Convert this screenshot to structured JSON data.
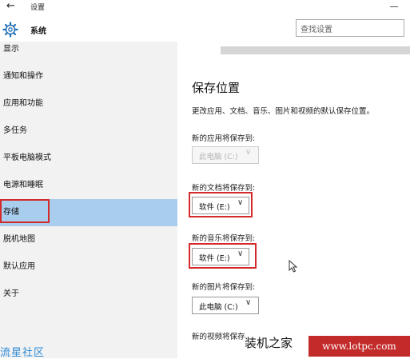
{
  "window": {
    "title": "设置",
    "back_glyph": "←"
  },
  "header": {
    "title": "系统",
    "search_placeholder": "查找设置"
  },
  "sidebar": {
    "items": [
      {
        "label": "显示"
      },
      {
        "label": "通知和操作"
      },
      {
        "label": "应用和功能"
      },
      {
        "label": "多任务"
      },
      {
        "label": "平板电脑模式"
      },
      {
        "label": "电源和睡眠"
      },
      {
        "label": "存储",
        "selected": true
      },
      {
        "label": "脱机地图"
      },
      {
        "label": "默认应用"
      },
      {
        "label": "关于"
      }
    ]
  },
  "main": {
    "title": "保存位置",
    "description": "更改应用、文档、音乐、图片和视频的默认保存位置。",
    "fields": [
      {
        "label": "新的应用将保存到:",
        "value": "此电脑 (C:)",
        "disabled": true,
        "highlighted": false
      },
      {
        "label": "新的文档将保存到:",
        "value": "软件 (E:)",
        "disabled": false,
        "highlighted": true
      },
      {
        "label": "新的音乐将保存到:",
        "value": "软件 (E:)",
        "disabled": false,
        "highlighted": true
      },
      {
        "label": "新的图片将保存到:",
        "value": "此电脑 (C:)",
        "disabled": false,
        "highlighted": false
      },
      {
        "label": "新的视频将保存",
        "value": "",
        "disabled": false,
        "highlighted": false
      }
    ],
    "chevron": "∨"
  },
  "watermark": {
    "left": "流星社区",
    "right_cn": "装机之家",
    "right_url": "www.lotpc.com"
  },
  "colors": {
    "selected_bg": "#a9cdec",
    "highlight_border": "#d42a2a",
    "accent": "#1f6fb5"
  },
  "icons": [
    "back-arrow-icon",
    "gear-icon",
    "chevron-down-icon",
    "mouse-cursor-icon"
  ]
}
